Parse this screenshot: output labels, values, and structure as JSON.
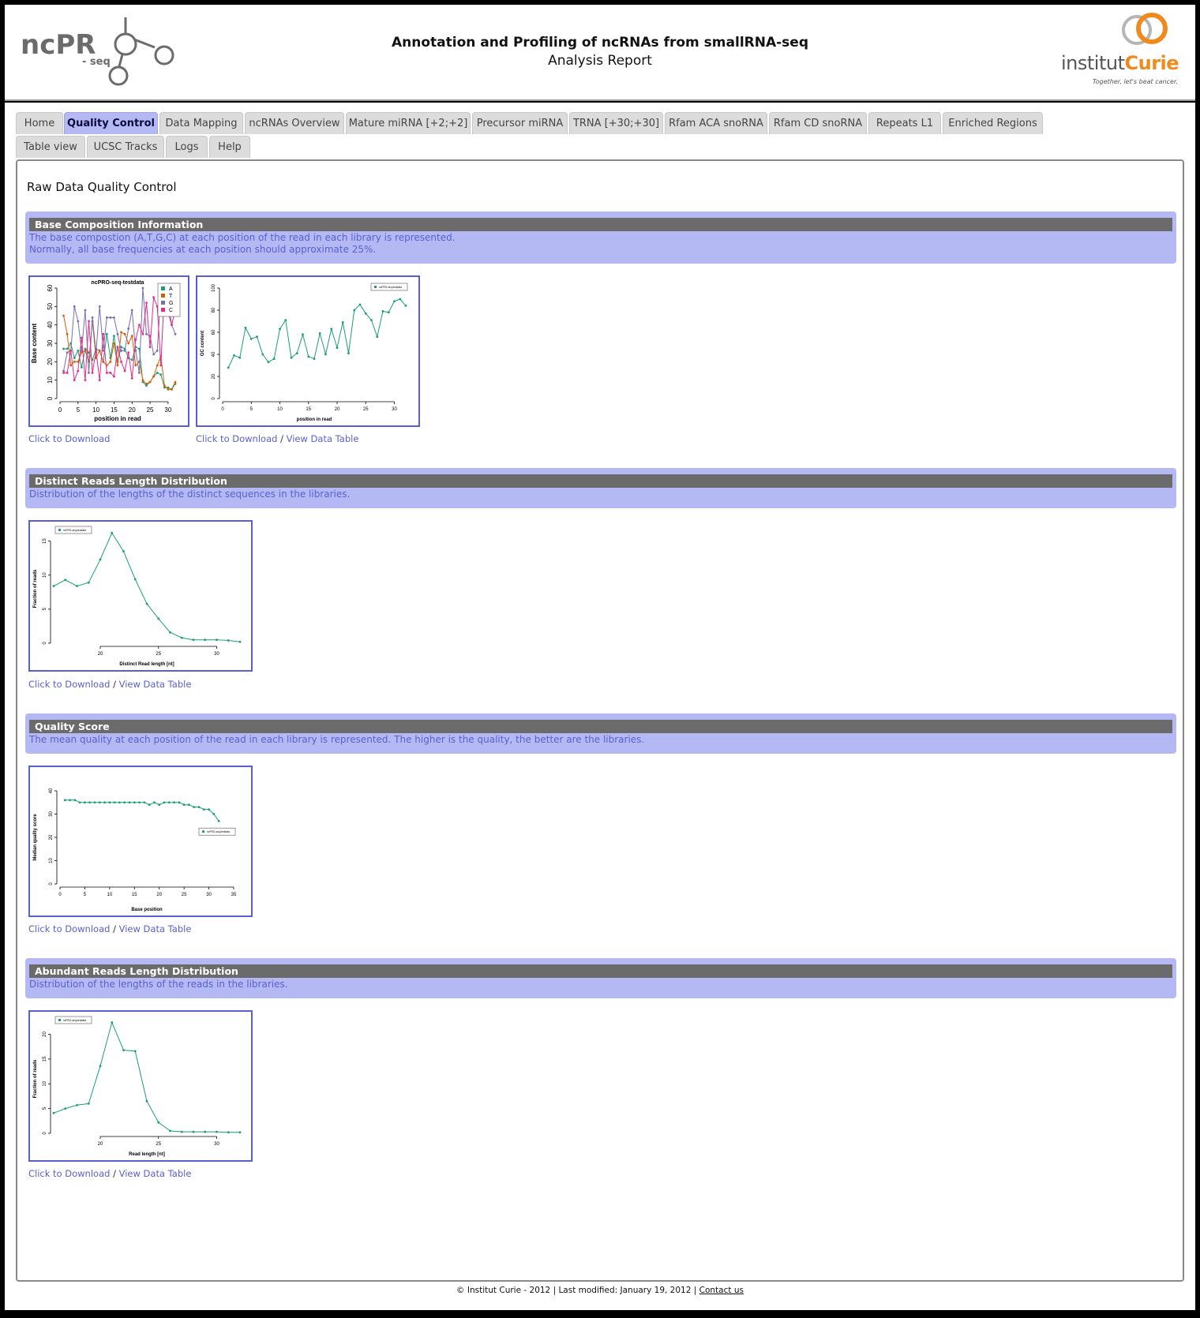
{
  "header": {
    "title": "Annotation and Profiling of ncRNAs from smallRNA-seq",
    "subtitle": "Analysis Report",
    "left_logo_text": "ncPR",
    "left_logo_sub": "- seq",
    "right_logo_prefix": "institut",
    "right_logo_brand": "Curie",
    "right_logo_tagline": "Together, let's beat cancer."
  },
  "tabs": [
    {
      "label": "Home",
      "active": false
    },
    {
      "label": "Quality Control",
      "active": true
    },
    {
      "label": "Data Mapping",
      "active": false
    },
    {
      "label": "ncRNAs Overview",
      "active": false
    },
    {
      "label": "Mature miRNA [+2;+2]",
      "active": false
    },
    {
      "label": "Precursor miRNA",
      "active": false
    },
    {
      "label": "TRNA [+30;+30]",
      "active": false
    },
    {
      "label": "Rfam ACA snoRNA",
      "active": false
    },
    {
      "label": "Rfam CD snoRNA",
      "active": false
    },
    {
      "label": "Repeats L1",
      "active": false
    },
    {
      "label": "Enriched Regions",
      "active": false
    },
    {
      "label": "Table view",
      "active": false
    },
    {
      "label": "UCSC Tracks",
      "active": false
    },
    {
      "label": "Logs",
      "active": false
    },
    {
      "label": "Help",
      "active": false
    }
  ],
  "page_title": "Raw Data Quality Control",
  "sections": [
    {
      "heading": "Base Composition Information",
      "desc_line1": "The base compostion (A,T,G,C) at each position of the read in each library is represented.",
      "desc_line2": "Normally, all base frequencies at each position should approximate 25%."
    },
    {
      "heading": "Distinct Reads Length Distribution",
      "desc_line1": "Distribution of the lengths of the distinct sequences in the libraries."
    },
    {
      "heading": "Quality Score",
      "desc_line1": "The mean quality at each position of the read in each library is represented. The higher is the quality, the better are the libraries."
    },
    {
      "heading": "Abundant Reads Length Distribution",
      "desc_line1": "Distribution of the lengths of the reads in the libraries."
    }
  ],
  "links": {
    "download": "Click to Download",
    "separator": "/",
    "view_table": "View Data Table"
  },
  "footer": {
    "text": "© Institut Curie - 2012 | Last modified: January 19, 2012 |",
    "contact": "Contact us"
  },
  "chart_data": [
    {
      "type": "line",
      "title": "ncPRO-seq-testdata",
      "xlabel": "position in read",
      "ylabel": "Base content",
      "xlim": [
        0,
        32
      ],
      "ylim": [
        0,
        60
      ],
      "xticks": [
        0,
        5,
        10,
        15,
        20,
        25,
        30
      ],
      "yticks": [
        0,
        10,
        20,
        30,
        40,
        50,
        60
      ],
      "legend_position": "top-right",
      "x": [
        1,
        2,
        3,
        4,
        5,
        6,
        7,
        8,
        9,
        10,
        11,
        12,
        13,
        14,
        15,
        16,
        17,
        18,
        19,
        20,
        21,
        22,
        23,
        24,
        25,
        26,
        27,
        28,
        29,
        30,
        31,
        32
      ],
      "series": [
        {
          "name": "A",
          "color": "#1a9e77",
          "values": [
            27,
            27,
            30,
            22,
            26,
            17,
            27,
            25,
            21,
            27,
            26,
            20,
            35,
            22,
            34,
            20,
            28,
            27,
            22,
            21,
            28,
            27,
            9,
            7,
            9,
            12,
            14,
            13,
            6,
            6,
            5,
            8
          ]
        },
        {
          "name": "T",
          "color": "#d95f02",
          "values": [
            45,
            35,
            18,
            20,
            20,
            25,
            26,
            20,
            42,
            22,
            26,
            20,
            18,
            20,
            30,
            18,
            36,
            35,
            30,
            34,
            18,
            20,
            10,
            8,
            9,
            12,
            18,
            23,
            7,
            5,
            5,
            9
          ]
        },
        {
          "name": "G",
          "color": "#7570b3",
          "values": [
            15,
            25,
            26,
            50,
            42,
            26,
            48,
            14,
            44,
            25,
            50,
            26,
            44,
            44,
            44,
            35,
            26,
            26,
            38,
            48,
            26,
            14,
            60,
            35,
            34,
            24,
            26,
            58,
            48,
            54,
            40,
            35
          ]
        },
        {
          "name": "C",
          "color": "#e7298a",
          "values": [
            14,
            14,
            26,
            10,
            15,
            33,
            10,
            42,
            14,
            26,
            10,
            35,
            14,
            14,
            12,
            28,
            20,
            15,
            25,
            11,
            32,
            40,
            35,
            52,
            28,
            55,
            50,
            18,
            59,
            47,
            40,
            48
          ]
        }
      ]
    },
    {
      "type": "line",
      "xlabel": "position in read",
      "ylabel": "GC content",
      "xlim": [
        0,
        32
      ],
      "ylim": [
        0,
        100
      ],
      "xticks": [
        0,
        5,
        10,
        15,
        20,
        25,
        30
      ],
      "yticks": [
        0,
        20,
        40,
        60,
        80,
        100
      ],
      "legend_position": "top-right",
      "series": [
        {
          "name": "ncPRO-seq-testdata",
          "color": "#1a9e77",
          "x": [
            1,
            2,
            3,
            4,
            5,
            6,
            7,
            8,
            9,
            10,
            11,
            12,
            13,
            14,
            15,
            16,
            17,
            18,
            19,
            20,
            21,
            22,
            23,
            24,
            25,
            26,
            27,
            28,
            29,
            30,
            31,
            32
          ],
          "values": [
            28,
            39,
            37,
            64,
            54,
            56,
            40,
            33,
            36,
            63,
            71,
            37,
            41,
            58,
            38,
            36,
            59,
            40,
            63,
            46,
            69,
            41,
            80,
            85,
            77,
            71,
            56,
            79,
            78,
            88,
            90,
            84
          ]
        }
      ]
    },
    {
      "type": "line",
      "xlabel": "Distinct Read length [nt]",
      "ylabel": "Fraction of reads",
      "xlim": [
        16,
        32
      ],
      "ylim": [
        0,
        16
      ],
      "xticks": [
        20,
        25,
        30
      ],
      "yticks": [
        0,
        5,
        10,
        15
      ],
      "legend_position": "top-left",
      "series": [
        {
          "name": "ncPRO-seq-testdata",
          "color": "#1a9e77",
          "x": [
            16,
            17,
            18,
            19,
            20,
            21,
            22,
            23,
            24,
            25,
            26,
            27,
            28,
            29,
            30,
            31,
            32
          ],
          "values": [
            8.4,
            9.3,
            8.4,
            8.9,
            12.3,
            16.2,
            13.5,
            9.4,
            5.8,
            3.6,
            1.6,
            0.8,
            0.5,
            0.5,
            0.5,
            0.4,
            0.2
          ]
        }
      ]
    },
    {
      "type": "line",
      "xlabel": "Base position",
      "ylabel": "Median quality score",
      "xlim": [
        0,
        35
      ],
      "ylim": [
        0,
        40
      ],
      "xticks": [
        0,
        5,
        10,
        15,
        20,
        25,
        30,
        35
      ],
      "yticks": [
        0,
        10,
        20,
        30,
        40
      ],
      "legend_position": "right",
      "series": [
        {
          "name": "ncPRO-seq-testdata",
          "color": "#1a9e77",
          "x": [
            1,
            2,
            3,
            4,
            5,
            6,
            7,
            8,
            9,
            10,
            11,
            12,
            13,
            14,
            15,
            16,
            17,
            18,
            19,
            20,
            21,
            22,
            23,
            24,
            25,
            26,
            27,
            28,
            29,
            30,
            31,
            32
          ],
          "values": [
            36,
            36,
            36,
            35,
            35,
            35,
            35,
            35,
            35,
            35,
            35,
            35,
            35,
            35,
            35,
            35,
            35,
            34,
            35,
            34,
            35,
            35,
            35,
            35,
            34,
            34,
            33,
            33,
            32,
            32,
            30,
            27
          ]
        }
      ]
    },
    {
      "type": "line",
      "xlabel": "Read length [nt]",
      "ylabel": "Fraction of reads",
      "xlim": [
        16,
        32
      ],
      "ylim": [
        0,
        22
      ],
      "xticks": [
        20,
        25,
        30
      ],
      "yticks": [
        0,
        5,
        10,
        15,
        20
      ],
      "legend_position": "top-left",
      "series": [
        {
          "name": "ncPRO-seq-testdata",
          "color": "#1a9e77",
          "x": [
            16,
            17,
            18,
            19,
            20,
            21,
            22,
            23,
            24,
            25,
            26,
            27,
            28,
            29,
            30,
            31,
            32
          ],
          "values": [
            4.1,
            5,
            5.7,
            6,
            13.6,
            22.4,
            16.8,
            16.6,
            6.5,
            2.2,
            0.5,
            0.3,
            0.3,
            0.3,
            0.3,
            0.2,
            0.2
          ]
        }
      ]
    }
  ]
}
